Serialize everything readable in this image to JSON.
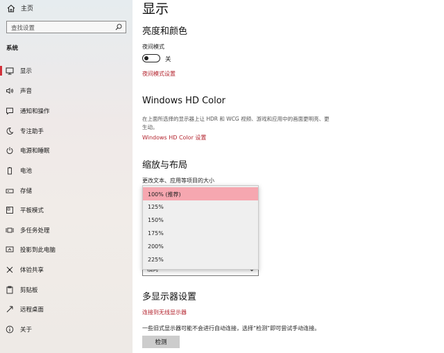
{
  "sidebar": {
    "home_label": "主页",
    "search_placeholder": "查找设置",
    "section_label": "系统",
    "items": [
      {
        "label": "显示",
        "icon": "monitor-icon"
      },
      {
        "label": "声音",
        "icon": "speaker-icon"
      },
      {
        "label": "通知和操作",
        "icon": "notification-icon"
      },
      {
        "label": "专注助手",
        "icon": "moon-icon"
      },
      {
        "label": "电源和睡眠",
        "icon": "power-icon"
      },
      {
        "label": "电池",
        "icon": "battery-icon"
      },
      {
        "label": "存储",
        "icon": "storage-icon"
      },
      {
        "label": "平板模式",
        "icon": "tablet-icon"
      },
      {
        "label": "多任务处理",
        "icon": "multitask-icon"
      },
      {
        "label": "投影到此电脑",
        "icon": "project-icon"
      },
      {
        "label": "体验共享",
        "icon": "share-icon"
      },
      {
        "label": "剪贴板",
        "icon": "clipboard-icon"
      },
      {
        "label": "远程桌面",
        "icon": "remote-icon"
      },
      {
        "label": "关于",
        "icon": "info-icon"
      }
    ]
  },
  "main": {
    "title": "显示",
    "brightness": {
      "heading": "亮度和颜色",
      "night_mode_label": "夜间模式",
      "toggle_state": "关",
      "night_settings_link": "夜间模式设置"
    },
    "hdr": {
      "heading": "Windows HD Color",
      "description": "在上面所选择的显示器上让 HDR 和 WCG 视频、游戏和应用中的画面更明亮、更生动。",
      "settings_link": "Windows HD Color 设置"
    },
    "scale": {
      "heading": "缩放与布局",
      "size_label": "更改文本、应用等项目的大小",
      "options": [
        "100% (推荐)",
        "125%",
        "150%",
        "175%",
        "200%",
        "225%"
      ],
      "selected_index": 0,
      "underlying_value": "横向"
    },
    "multi": {
      "heading": "多显示器设置",
      "wireless_link": "连接到无线显示器",
      "note": "一些旧式显示器可能不会进行自动连接，选择“检测”即可尝试手动连接。",
      "detect_button": "检测"
    }
  },
  "colors": {
    "accent": "#d1303a",
    "link": "#b3232d",
    "selected_option": "#f6a7b0"
  }
}
